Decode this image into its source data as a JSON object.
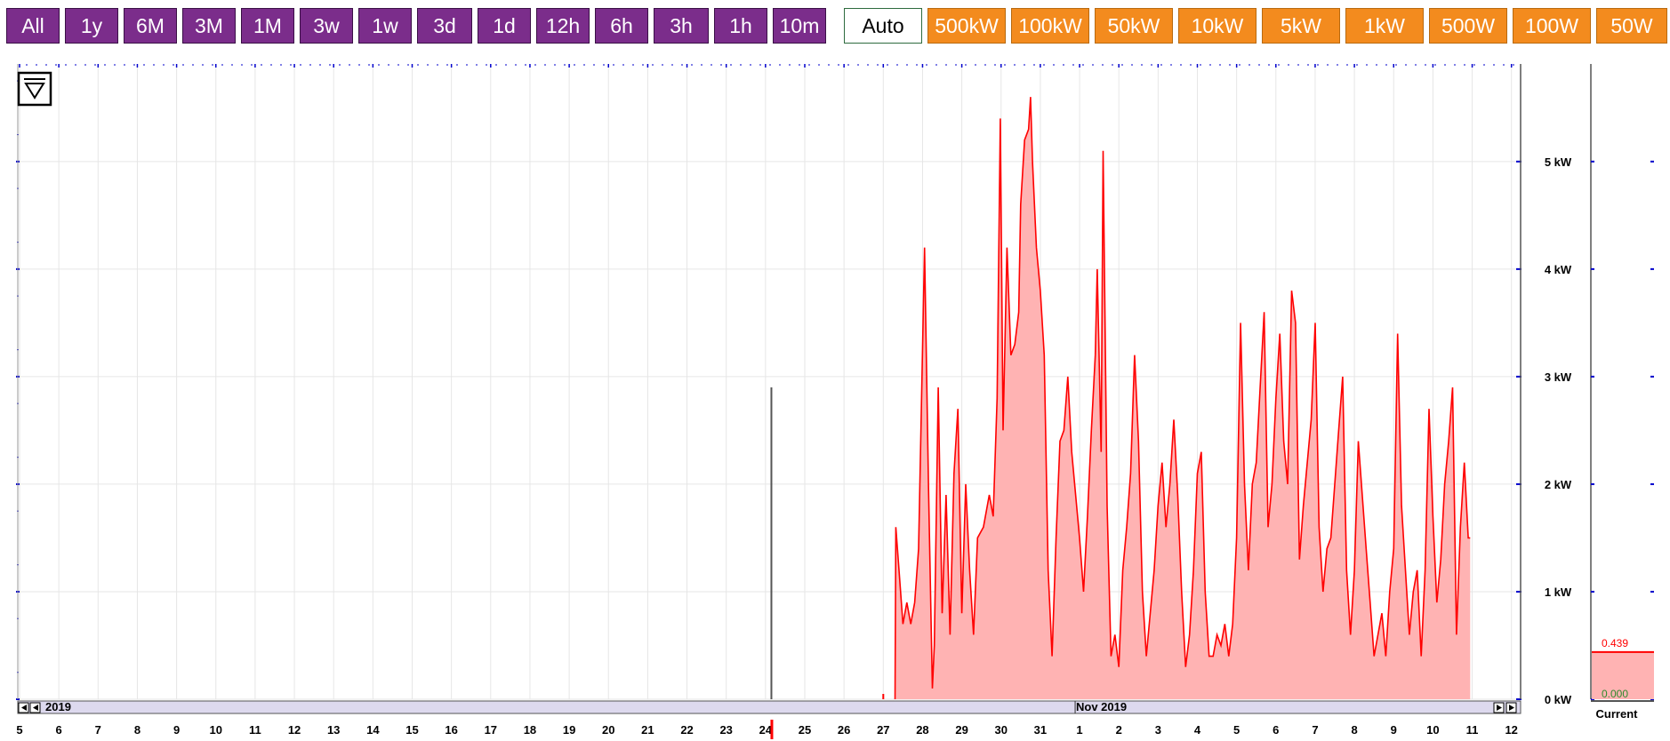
{
  "toolbar": {
    "range_buttons": [
      "All",
      "1y",
      "6M",
      "3M",
      "1M",
      "3w",
      "1w",
      "3d",
      "1d",
      "12h",
      "6h",
      "3h",
      "1h",
      "10m"
    ],
    "auto_label": "Auto",
    "scale_buttons": [
      "500kW",
      "100kW",
      "50kW",
      "10kW",
      "5kW",
      "1kW",
      "500W",
      "100W",
      "50W"
    ]
  },
  "colors": {
    "range_button": "#7b2d8b",
    "scale_button": "#f38b1e",
    "series": "#ff0000",
    "series_fill": "#ffb3b3",
    "spike": "#555555"
  },
  "chart_data": {
    "type": "area",
    "x_tick_labels": [
      "5",
      "6",
      "7",
      "8",
      "9",
      "10",
      "11",
      "12",
      "13",
      "14",
      "15",
      "16",
      "17",
      "18",
      "19",
      "20",
      "21",
      "22",
      "23",
      "24",
      "25",
      "26",
      "27",
      "28",
      "29",
      "30",
      "31",
      "1",
      "2",
      "3",
      "4",
      "5",
      "6",
      "7",
      "8",
      "9",
      "10",
      "11",
      "12"
    ],
    "y_tick_labels": [
      "0 kW",
      "1 kW",
      "2 kW",
      "3 kW",
      "4 kW",
      "5 kW"
    ],
    "ylim": [
      0,
      5.8
    ],
    "month_labels": [
      "2019",
      "Nov 2019"
    ],
    "series": [
      {
        "values": [
          [
            27.3,
            0.0
          ],
          [
            27.32,
            1.6
          ],
          [
            27.4,
            1.2
          ],
          [
            27.5,
            0.7
          ],
          [
            27.6,
            0.9
          ],
          [
            27.7,
            0.7
          ],
          [
            27.8,
            0.9
          ],
          [
            27.9,
            1.4
          ],
          [
            28.05,
            4.2
          ],
          [
            28.15,
            2.0
          ],
          [
            28.25,
            0.1
          ],
          [
            28.3,
            0.5
          ],
          [
            28.4,
            2.9
          ],
          [
            28.5,
            0.8
          ],
          [
            28.6,
            1.9
          ],
          [
            28.7,
            0.6
          ],
          [
            28.8,
            2.1
          ],
          [
            28.9,
            2.7
          ],
          [
            29.0,
            0.8
          ],
          [
            29.1,
            2.0
          ],
          [
            29.2,
            1.2
          ],
          [
            29.3,
            0.6
          ],
          [
            29.4,
            1.5
          ],
          [
            29.55,
            1.6
          ],
          [
            29.7,
            1.9
          ],
          [
            29.8,
            1.7
          ],
          [
            29.9,
            2.8
          ],
          [
            29.98,
            5.4
          ],
          [
            30.05,
            2.5
          ],
          [
            30.15,
            4.2
          ],
          [
            30.25,
            3.2
          ],
          [
            30.35,
            3.3
          ],
          [
            30.45,
            3.6
          ],
          [
            30.5,
            4.6
          ],
          [
            30.6,
            5.2
          ],
          [
            30.7,
            5.3
          ],
          [
            30.75,
            5.6
          ],
          [
            30.8,
            5.0
          ],
          [
            30.9,
            4.2
          ],
          [
            31.0,
            3.8
          ],
          [
            31.1,
            3.2
          ],
          [
            31.2,
            1.2
          ],
          [
            31.3,
            0.4
          ],
          [
            31.4,
            1.5
          ],
          [
            31.5,
            2.4
          ],
          [
            31.6,
            2.5
          ],
          [
            31.7,
            3.0
          ],
          [
            31.8,
            2.3
          ],
          [
            31.9,
            1.9
          ],
          [
            32.0,
            1.5
          ],
          [
            32.1,
            1.0
          ],
          [
            32.2,
            1.7
          ],
          [
            32.3,
            2.5
          ],
          [
            32.4,
            3.2
          ],
          [
            32.45,
            4.0
          ],
          [
            32.55,
            2.3
          ],
          [
            32.6,
            5.1
          ],
          [
            32.7,
            1.8
          ],
          [
            32.8,
            0.4
          ],
          [
            32.9,
            0.6
          ],
          [
            33.0,
            0.3
          ],
          [
            33.1,
            1.2
          ],
          [
            33.2,
            1.6
          ],
          [
            33.3,
            2.1
          ],
          [
            33.4,
            3.2
          ],
          [
            33.5,
            2.4
          ],
          [
            33.6,
            1.0
          ],
          [
            33.7,
            0.4
          ],
          [
            33.8,
            0.8
          ],
          [
            33.9,
            1.2
          ],
          [
            34.0,
            1.8
          ],
          [
            34.1,
            2.2
          ],
          [
            34.2,
            1.6
          ],
          [
            34.3,
            2.0
          ],
          [
            34.4,
            2.6
          ],
          [
            34.5,
            1.9
          ],
          [
            34.6,
            1.0
          ],
          [
            34.7,
            0.3
          ],
          [
            34.8,
            0.6
          ],
          [
            34.9,
            1.2
          ],
          [
            35.0,
            2.1
          ],
          [
            35.1,
            2.3
          ],
          [
            35.2,
            1.0
          ],
          [
            35.3,
            0.4
          ],
          [
            35.4,
            0.4
          ],
          [
            35.5,
            0.6
          ],
          [
            35.6,
            0.5
          ],
          [
            35.7,
            0.7
          ],
          [
            35.8,
            0.4
          ],
          [
            35.9,
            0.7
          ],
          [
            36.0,
            1.5
          ],
          [
            36.1,
            3.5
          ],
          [
            36.2,
            2.0
          ],
          [
            36.3,
            1.2
          ],
          [
            36.4,
            2.0
          ],
          [
            36.5,
            2.2
          ],
          [
            36.6,
            2.9
          ],
          [
            36.7,
            3.6
          ],
          [
            36.8,
            1.6
          ],
          [
            36.9,
            2.0
          ],
          [
            37.0,
            2.8
          ],
          [
            37.1,
            3.4
          ],
          [
            37.2,
            2.4
          ],
          [
            37.3,
            2.0
          ],
          [
            37.4,
            3.8
          ],
          [
            37.5,
            3.5
          ],
          [
            37.6,
            1.3
          ],
          [
            37.7,
            1.8
          ],
          [
            37.8,
            2.2
          ],
          [
            37.9,
            2.6
          ],
          [
            38.0,
            3.5
          ],
          [
            38.1,
            1.6
          ],
          [
            38.2,
            1.0
          ],
          [
            38.3,
            1.4
          ],
          [
            38.4,
            1.5
          ],
          [
            38.5,
            2.0
          ],
          [
            38.6,
            2.5
          ],
          [
            38.7,
            3.0
          ],
          [
            38.8,
            1.2
          ],
          [
            38.9,
            0.6
          ],
          [
            39.0,
            1.2
          ],
          [
            39.1,
            2.4
          ],
          [
            39.2,
            1.9
          ],
          [
            39.3,
            1.4
          ],
          [
            39.4,
            0.9
          ],
          [
            39.5,
            0.4
          ],
          [
            39.6,
            0.6
          ],
          [
            39.7,
            0.8
          ],
          [
            39.8,
            0.4
          ],
          [
            39.9,
            1.0
          ],
          [
            40.0,
            1.4
          ],
          [
            40.1,
            3.4
          ],
          [
            40.2,
            1.8
          ],
          [
            40.3,
            1.2
          ],
          [
            40.4,
            0.6
          ],
          [
            40.5,
            1.0
          ],
          [
            40.6,
            1.2
          ],
          [
            40.7,
            0.4
          ],
          [
            40.8,
            1.2
          ],
          [
            40.9,
            2.7
          ],
          [
            41.0,
            1.7
          ],
          [
            41.1,
            0.9
          ],
          [
            41.2,
            1.3
          ],
          [
            41.3,
            2.0
          ],
          [
            41.4,
            2.4
          ],
          [
            41.5,
            2.9
          ],
          [
            41.6,
            0.6
          ],
          [
            41.7,
            1.6
          ],
          [
            41.8,
            2.2
          ],
          [
            41.9,
            1.5
          ],
          [
            41.95,
            1.5
          ]
        ]
      }
    ],
    "spike": {
      "x": 24.15,
      "y": 2.9
    },
    "current_panel": {
      "label": "Current",
      "value": "0.439",
      "baseline": "0.000",
      "level": 0.439
    }
  }
}
